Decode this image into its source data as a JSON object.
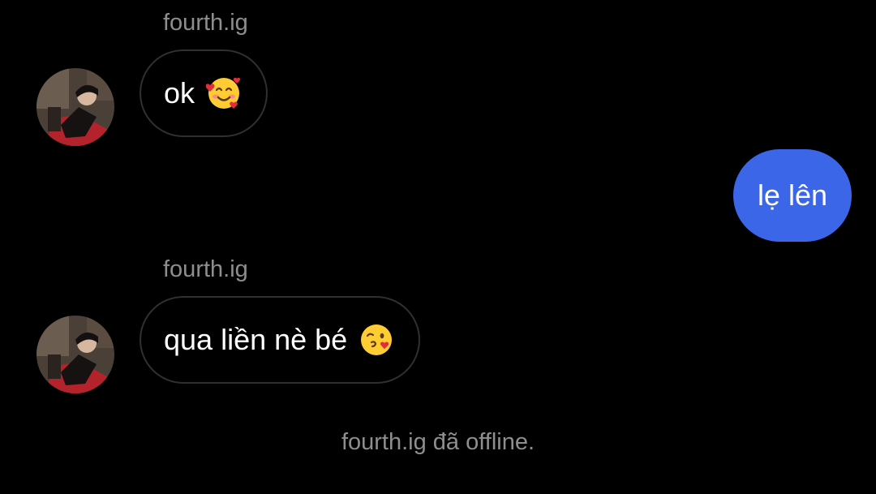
{
  "conversation": {
    "messages": [
      {
        "sender": "fourth.ig",
        "text": "ok",
        "emoji": "smiling-face-with-hearts-icon",
        "direction": "incoming"
      },
      {
        "text": "lẹ lên",
        "direction": "outgoing"
      },
      {
        "sender": "fourth.ig",
        "text": "qua liền nè bé",
        "emoji": "face-blowing-kiss-icon",
        "direction": "incoming"
      }
    ],
    "status": "fourth.ig đã offline."
  },
  "colors": {
    "background": "#000000",
    "outgoing_bubble": "#3b66e8",
    "incoming_bubble_border": "#303030",
    "muted_text": "#8e8e8e"
  }
}
